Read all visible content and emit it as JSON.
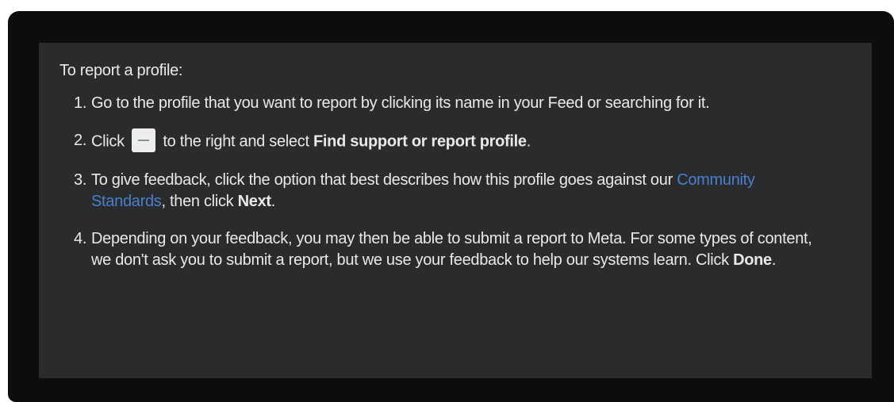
{
  "intro": "To report a profile:",
  "steps": [
    {
      "num": "1.",
      "text": "Go to the profile that you want to report by clicking its name in your Feed or searching for it."
    },
    {
      "num": "2.",
      "pre": "Click",
      "icon": "more-options-icon",
      "mid": "to the right and select",
      "bold": "Find support or report profile",
      "post": "."
    },
    {
      "num": "3.",
      "pre": "To give feedback, click the option that best describes how this profile goes against our",
      "link": "Community Standards",
      "mid": ", then click",
      "bold": "Next",
      "post": "."
    },
    {
      "num": "4.",
      "pre": "Depending on your feedback, you may then be able to submit a report to Meta. For some types of content, we don't ask you to submit a report, but we use your feedback to help our systems learn. Click",
      "bold": "Done",
      "post": "."
    }
  ],
  "colors": {
    "frame": "#0d0d0d",
    "panel": "#2a2b2c",
    "text": "#e9e9e9",
    "link": "#4a7fcf",
    "button": "#eceded"
  }
}
